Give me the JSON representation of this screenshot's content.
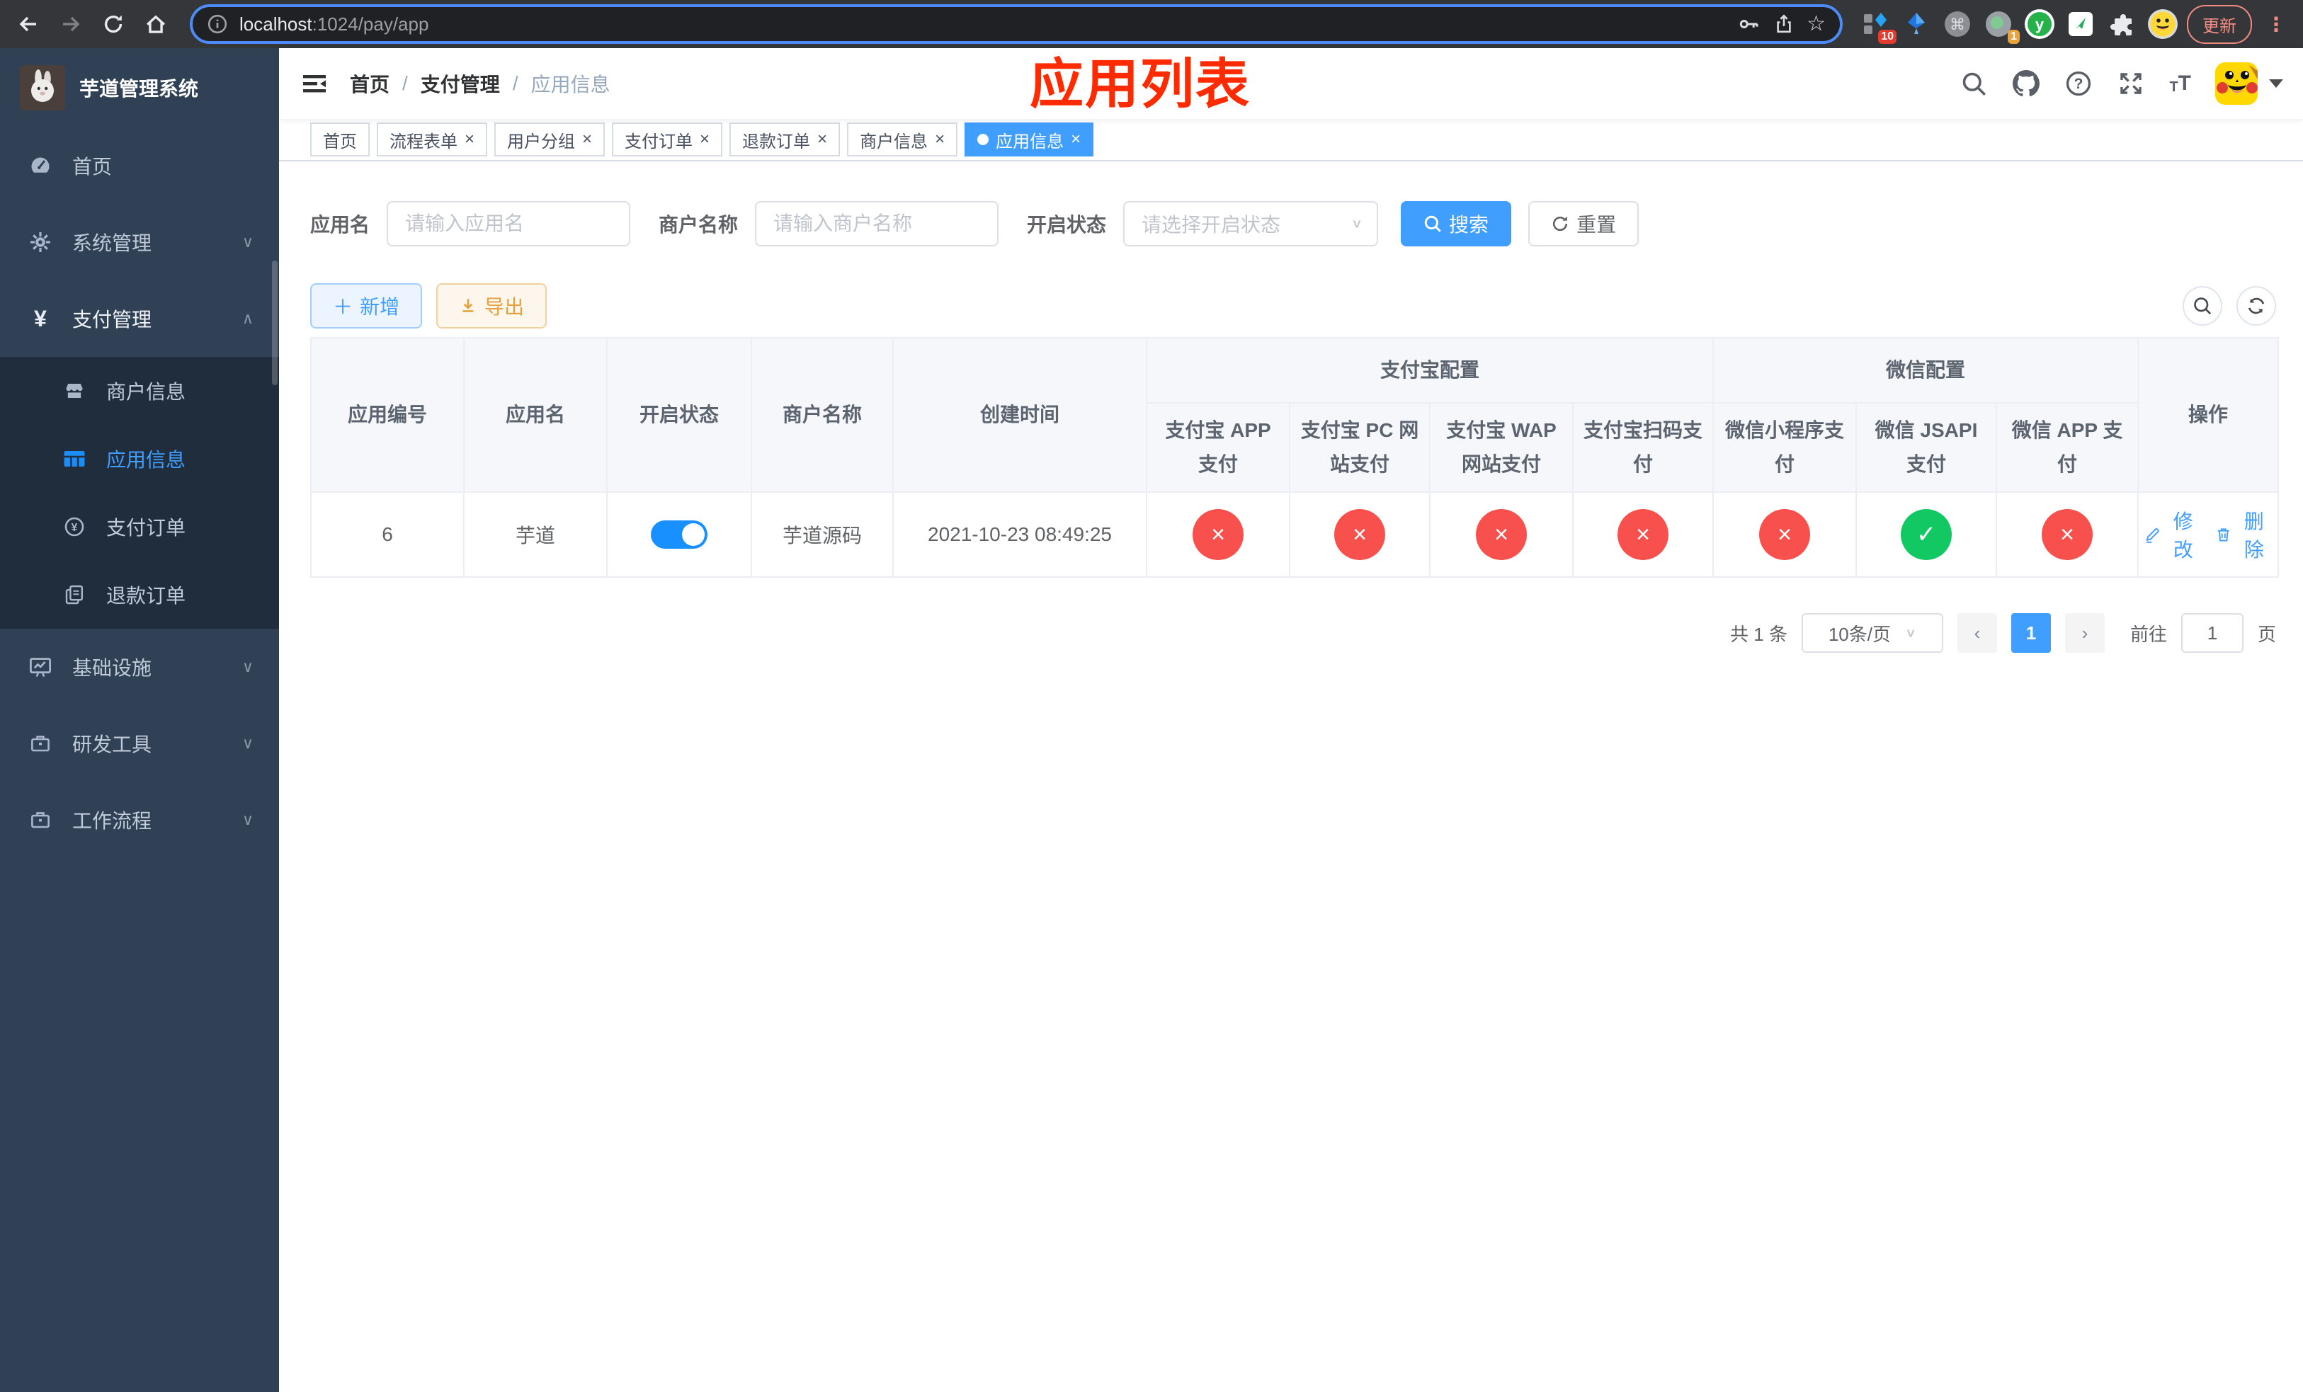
{
  "browser": {
    "url_host": "localhost",
    "url_rest": ":1024/pay/app",
    "update_label": "更新",
    "ext_badge_10": "10",
    "ext_badge_1": "1"
  },
  "sidebar": {
    "logo_title": "芋道管理系统",
    "items": [
      {
        "label": "首页"
      },
      {
        "label": "系统管理"
      },
      {
        "label": "支付管理"
      },
      {
        "label": "商户信息"
      },
      {
        "label": "应用信息"
      },
      {
        "label": "支付订单"
      },
      {
        "label": "退款订单"
      },
      {
        "label": "基础设施"
      },
      {
        "label": "研发工具"
      },
      {
        "label": "工作流程"
      }
    ]
  },
  "navbar": {
    "breadcrumb": [
      "首页",
      "支付管理",
      "应用信息"
    ],
    "separator": "/"
  },
  "annotation": {
    "text": "应用列表",
    "color": "#fe2a00"
  },
  "tabs": {
    "close_glyph": "×",
    "items": [
      {
        "label": "首页"
      },
      {
        "label": "流程表单"
      },
      {
        "label": "用户分组"
      },
      {
        "label": "支付订单"
      },
      {
        "label": "退款订单"
      },
      {
        "label": "商户信息"
      },
      {
        "label": "应用信息"
      }
    ]
  },
  "search": {
    "app_name_label": "应用名",
    "app_name_placeholder": "请输入应用名",
    "merchant_label": "商户名称",
    "merchant_placeholder": "请输入商户名称",
    "status_label": "开启状态",
    "status_placeholder": "请选择开启状态",
    "search_button": "搜索",
    "reset_button": "重置"
  },
  "toolbar": {
    "add_button": "新增",
    "export_button": "导出"
  },
  "table": {
    "group_headers": {
      "alipay": "支付宝配置",
      "wechat": "微信配置"
    },
    "columns": [
      "应用编号",
      "应用名",
      "开启状态",
      "商户名称",
      "创建时间",
      "支付宝 APP 支付",
      "支付宝 PC 网站支付",
      "支付宝 WAP 网站支付",
      "支付宝扫码支付",
      "微信小程序支付",
      "微信 JSAPI 支付",
      "微信 APP 支付",
      "操作"
    ],
    "rows": [
      {
        "id": "6",
        "name": "芋道",
        "enabled": true,
        "merchant": "芋道源码",
        "created_at": "2021-10-23 08:49:25",
        "statuses": [
          false,
          false,
          false,
          false,
          false,
          true,
          false
        ],
        "edit_label": "修改",
        "delete_label": "删除"
      }
    ]
  },
  "pagination": {
    "total_text": "共 1 条",
    "page_size": "10条/页",
    "current_page": "1",
    "goto_label": "前往",
    "goto_value": "1",
    "page_unit": "页"
  }
}
